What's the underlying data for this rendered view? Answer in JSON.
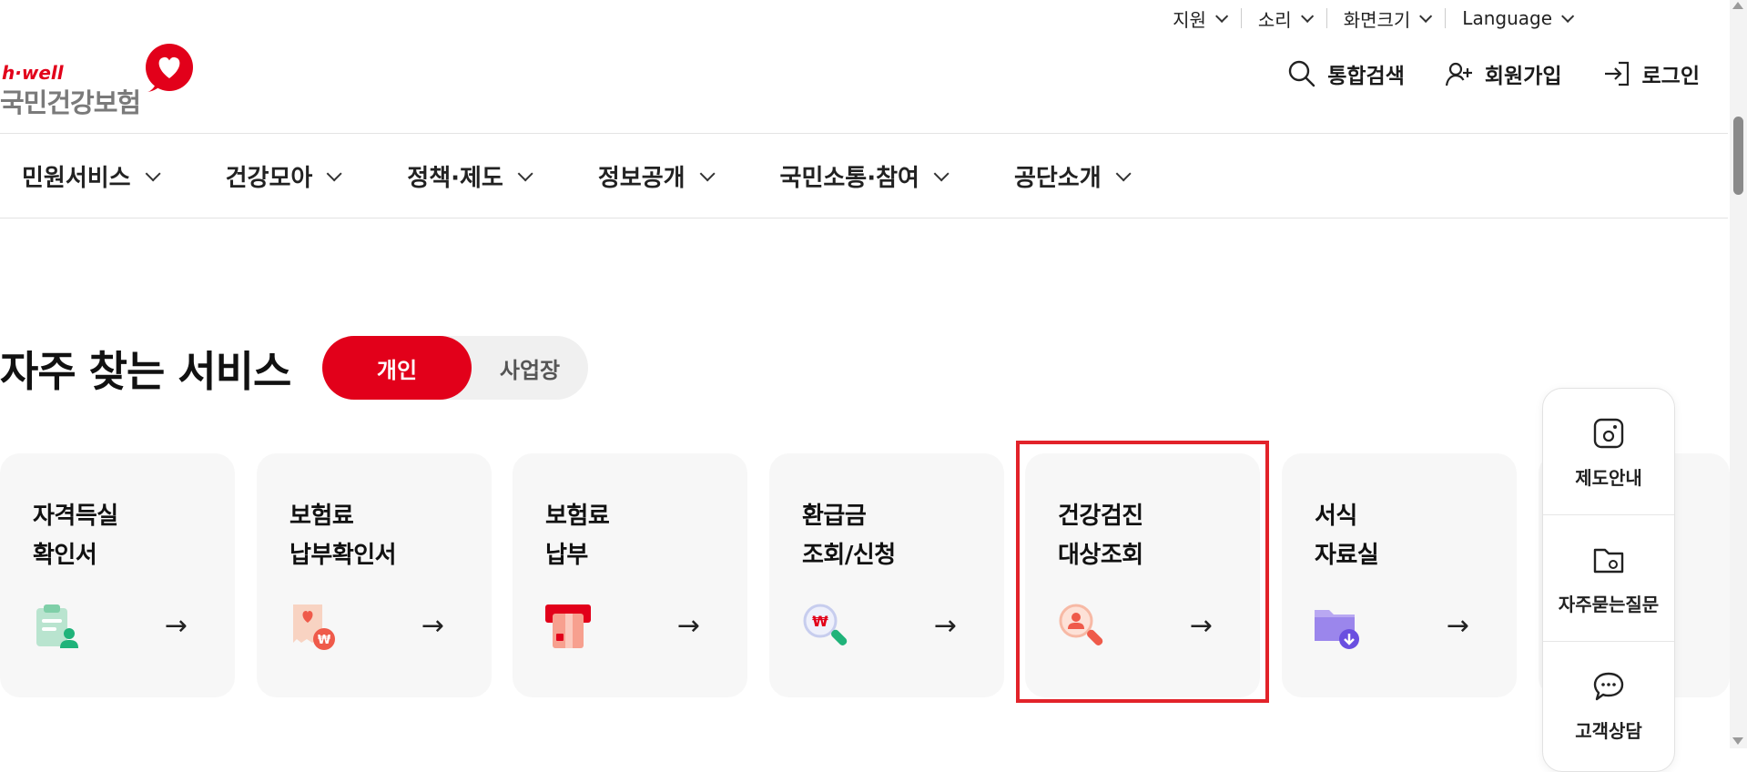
{
  "util": {
    "items": [
      {
        "label": "지원"
      },
      {
        "label": "소리"
      },
      {
        "label": "화면크기"
      },
      {
        "label": "Language"
      }
    ]
  },
  "logo": {
    "tagline": "h·well",
    "name": "국민건강보험"
  },
  "header": {
    "search_label": "통합검색",
    "join_label": "회원가입",
    "login_label": "로그인"
  },
  "gnb": {
    "menus": [
      "민원서비스",
      "건강모아",
      "정책·제도",
      "정보공개",
      "국민소통·참여",
      "공단소개"
    ]
  },
  "section": {
    "title": "자주 찾는 서비스",
    "toggle_on": "개인",
    "toggle_off": "사업장"
  },
  "cards": [
    {
      "line1": "자격득실",
      "line2": "확인서",
      "icon": "clipboard-person-icon",
      "arrow": "→"
    },
    {
      "line1": "보험료",
      "line2": "납부확인서",
      "icon": "receipt-won-icon",
      "arrow": "→"
    },
    {
      "line1": "보험료",
      "line2": "납부",
      "icon": "card-payment-icon",
      "arrow": "→"
    },
    {
      "line1": "환급금",
      "line2": "조회/신청",
      "icon": "magnifier-won-icon",
      "arrow": "→"
    },
    {
      "line1": "건강검진",
      "line2": "대상조회",
      "icon": "magnifier-person-icon",
      "arrow": "→"
    },
    {
      "line1": "서식",
      "line2": "자료실",
      "icon": "folder-download-icon",
      "arrow": "→"
    }
  ],
  "quick": {
    "items": [
      {
        "label": "제도안내",
        "icon": "guide-icon"
      },
      {
        "label": "자주묻는질문",
        "icon": "faq-folder-icon"
      },
      {
        "label": "고객상담",
        "icon": "chat-icon"
      }
    ]
  },
  "colors": {
    "brand_red": "#e2001a",
    "highlight": "#e2232a",
    "card_bg": "#f7f7f7"
  }
}
